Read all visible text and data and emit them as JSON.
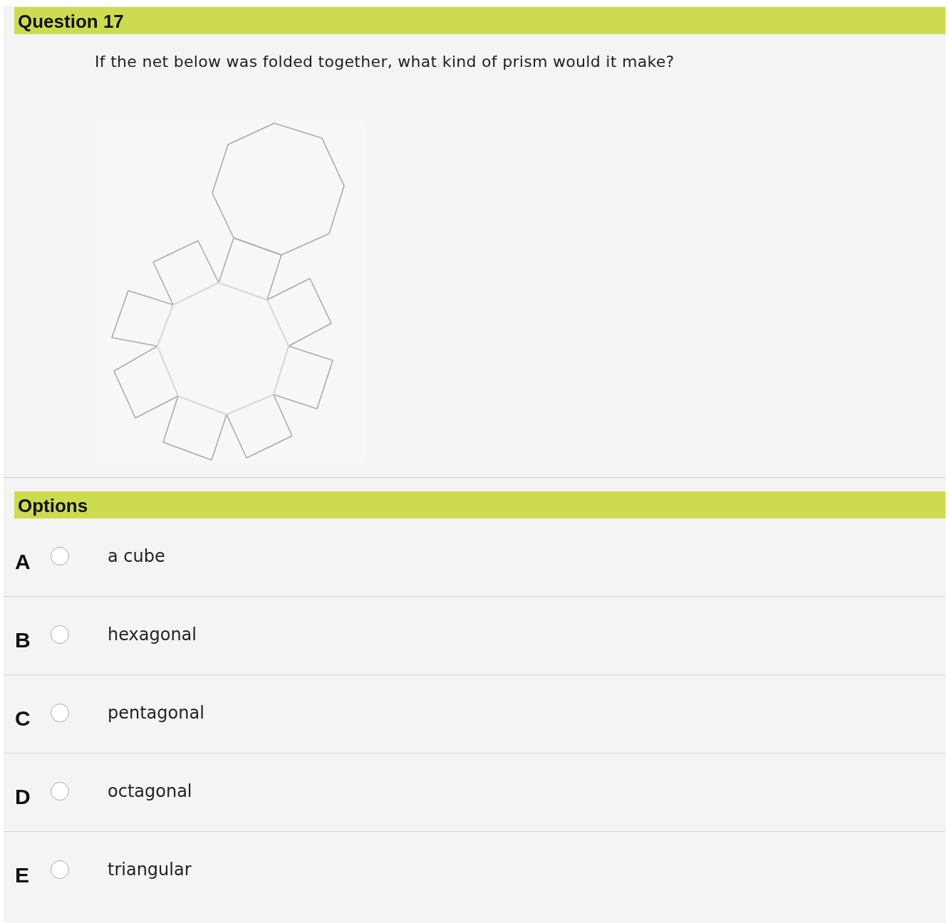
{
  "question": {
    "title": "Question 17",
    "text": "If the net below was folded together, what kind of prism would it make?"
  },
  "options_header": "Options",
  "options": [
    {
      "letter": "A",
      "label": "a cube",
      "selected": false
    },
    {
      "letter": "B",
      "label": "hexagonal",
      "selected": false
    },
    {
      "letter": "C",
      "label": "pentagonal",
      "selected": false
    },
    {
      "letter": "D",
      "label": "octagonal",
      "selected": false
    },
    {
      "letter": "E",
      "label": "triangular",
      "selected": false
    }
  ]
}
